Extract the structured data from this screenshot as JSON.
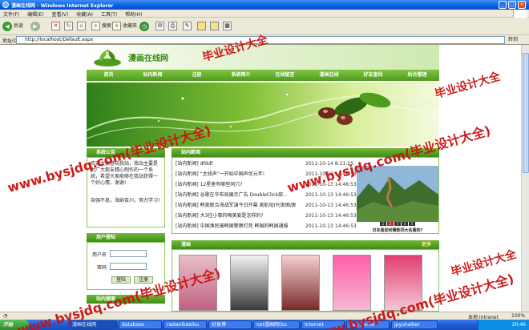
{
  "window": {
    "title": "漫画在线网 - Windows Internet Explorer",
    "min_label": "_",
    "max_label": "□",
    "close_label": "×"
  },
  "menu": [
    "文件(F)",
    "编辑(E)",
    "查看(V)",
    "收藏(A)",
    "工具(T)",
    "帮助(H)"
  ],
  "toolbar": {
    "back_label": "后退",
    "search_label": "搜索",
    "favorites_label": "收藏夹"
  },
  "address": {
    "label": "地址(D)",
    "url": "http://localhost/Default.aspx",
    "go_label": "转到"
  },
  "site": {
    "name": "漫画在线网",
    "nav": [
      "首页",
      "站内新闻",
      "注册",
      "系统简介",
      "在线留言",
      "漫画在线",
      "好友查找",
      "后台管理"
    ],
    "notice": {
      "title": "系统公告",
      "text": "欢迎大家登陆我站，我站主要是为广大歌友精心制作的一个系统，希望大家能够在我站获得一个好心情，谢谢!",
      "sign": "自强不息，海纳百川，努力学习!"
    },
    "login": {
      "title": "用户登陆",
      "user_label": "用户名",
      "password_label": "密码",
      "login_button": "登陆",
      "register_button": "注册"
    },
    "friend_links": {
      "title": "站内搜索"
    },
    "news": {
      "title": "站内新闻",
      "items": [
        {
          "title": "[站内新闻] dfddf",
          "date": "2011-10-14 8:21:25"
        },
        {
          "title": "[站内新闻] “主线声”一开始中国声优元年!",
          "date": "2011-10-13 14:46:53"
        },
        {
          "title": "[站内新闻] 12星座有哪些同穴?",
          "date": "2011-10-13 14:46:53"
        },
        {
          "title": "[站内新闻] 谷歌在华布局展示广告 DoubleClick部...",
          "date": "2011-10-13 14:46:53"
        },
        {
          "title": "[站内新闻] 韩美联合海战军演今日开幕 美航母(刊发图/图)",
          "date": "2011-10-13 14:46:53"
        },
        {
          "title": "[站内新闻] 大3往小事的晦美爱是怎样的?",
          "date": "2011-10-13 14:46:53"
        },
        {
          "title": "[站内新闻] 中国渔民被韩国警察打死 韩国的韩国通报",
          "date": "2011-10-13 14:46:53"
        }
      ],
      "photo_caption": "日本是如何褒贬同大名著的?",
      "photo_pages": [
        "1",
        "2",
        "3",
        "4",
        "5"
      ]
    },
    "comics": {
      "title": "漫画",
      "more_label": "更多"
    }
  },
  "statusbar": {
    "zone": "本地 Intranet",
    "zoom": "100%"
  },
  "taskbar": {
    "start_label": "开始",
    "tasks": [
      "漫画在线网",
      "database",
      "radwolkdeiku",
      "好易博",
      "net漫画网(bu",
      "Internet",
      "SQL Server",
      "jpyuhaiber"
    ],
    "clock": "20:46"
  },
  "watermark": {
    "text_url": "www.bysjdq.com(毕业设计大全)",
    "text_short": "毕业设计大全"
  },
  "colors": {
    "site_green": "#4f9c1e",
    "watermark_red": "#cc1111",
    "xp_blue": "#0a5ee0"
  }
}
